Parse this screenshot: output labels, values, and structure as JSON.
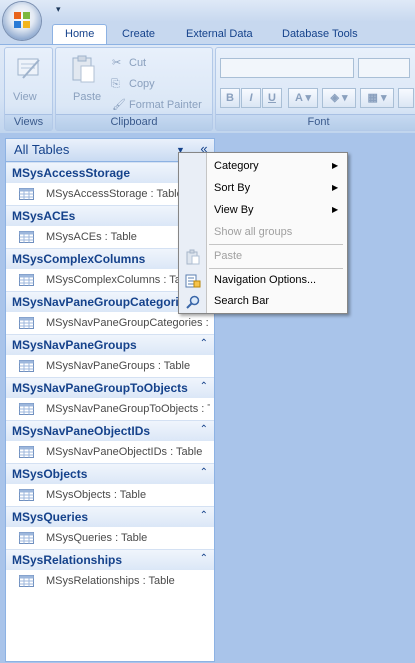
{
  "ribbon": {
    "tabs": [
      "Home",
      "Create",
      "External Data",
      "Database Tools"
    ],
    "groups": {
      "views": {
        "label": "Views",
        "view_button": "View"
      },
      "clipboard": {
        "label": "Clipboard",
        "paste": "Paste",
        "cut": "Cut",
        "copy": "Copy",
        "format_painter": "Format Painter"
      },
      "font": {
        "label": "Font",
        "bold": "B",
        "italic": "I",
        "underline": "U",
        "font_color": "A"
      }
    }
  },
  "nav_pane": {
    "title": "All Tables",
    "shutter": "«",
    "groups": [
      {
        "name": "MSysAccessStorage",
        "item": "MSysAccessStorage : Table"
      },
      {
        "name": "MSysACEs",
        "item": "MSysACEs : Table"
      },
      {
        "name": "MSysComplexColumns",
        "item": "MSysComplexColumns : Table"
      },
      {
        "name": "MSysNavPaneGroupCategories",
        "item": "MSysNavPaneGroupCategories : Table"
      },
      {
        "name": "MSysNavPaneGroups",
        "item": "MSysNavPaneGroups : Table"
      },
      {
        "name": "MSysNavPaneGroupToObjects",
        "item": "MSysNavPaneGroupToObjects : Table"
      },
      {
        "name": "MSysNavPaneObjectIDs",
        "item": "MSysNavPaneObjectIDs : Table"
      },
      {
        "name": "MSysObjects",
        "item": "MSysObjects : Table"
      },
      {
        "name": "MSysQueries",
        "item": "MSysQueries : Table"
      },
      {
        "name": "MSysRelationships",
        "item": "MSysRelationships : Table"
      }
    ]
  },
  "context_menu": {
    "items": [
      {
        "label": "Category",
        "submenu": true,
        "enabled": true
      },
      {
        "label": "Sort By",
        "submenu": true,
        "enabled": true
      },
      {
        "label": "View By",
        "submenu": true,
        "enabled": true
      },
      {
        "label": "Show all groups",
        "submenu": false,
        "enabled": false
      },
      {
        "label": "Paste",
        "submenu": false,
        "enabled": false
      },
      {
        "label": "Navigation Options...",
        "submenu": false,
        "enabled": true
      },
      {
        "label": "Search Bar",
        "submenu": false,
        "enabled": true
      }
    ]
  }
}
